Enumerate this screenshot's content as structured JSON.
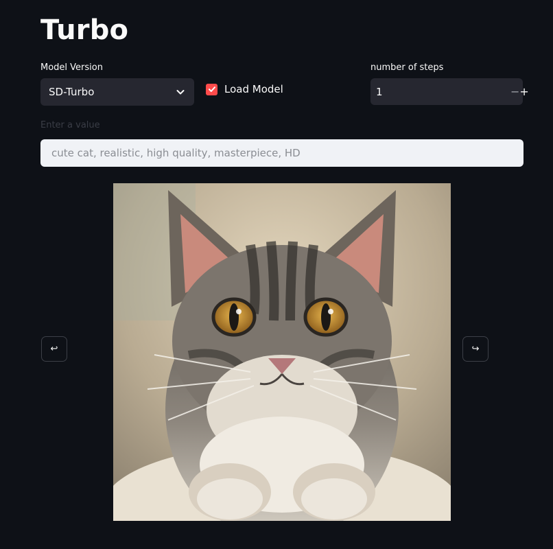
{
  "page": {
    "title": "Turbo"
  },
  "model_version": {
    "label": "Model Version",
    "selected": "SD-Turbo"
  },
  "load_model": {
    "label": "Load Model",
    "checked": true
  },
  "steps": {
    "label": "number of steps",
    "value": "1",
    "minus": "−",
    "plus": "+"
  },
  "prompt": {
    "label": "Enter a value",
    "placeholder": "cute cat, realistic, high quality, masterpiece, HD"
  },
  "navigation": {
    "prev_glyph": "↩",
    "next_glyph": "↪"
  },
  "icons": {
    "select": "chevron-down-icon",
    "checkbox": "check-icon",
    "image": "generated-cat-image"
  },
  "colors": {
    "background": "#0e1117",
    "accent": "#ff4b4b",
    "widget": "#262730",
    "input_light": "#f0f2f6"
  }
}
